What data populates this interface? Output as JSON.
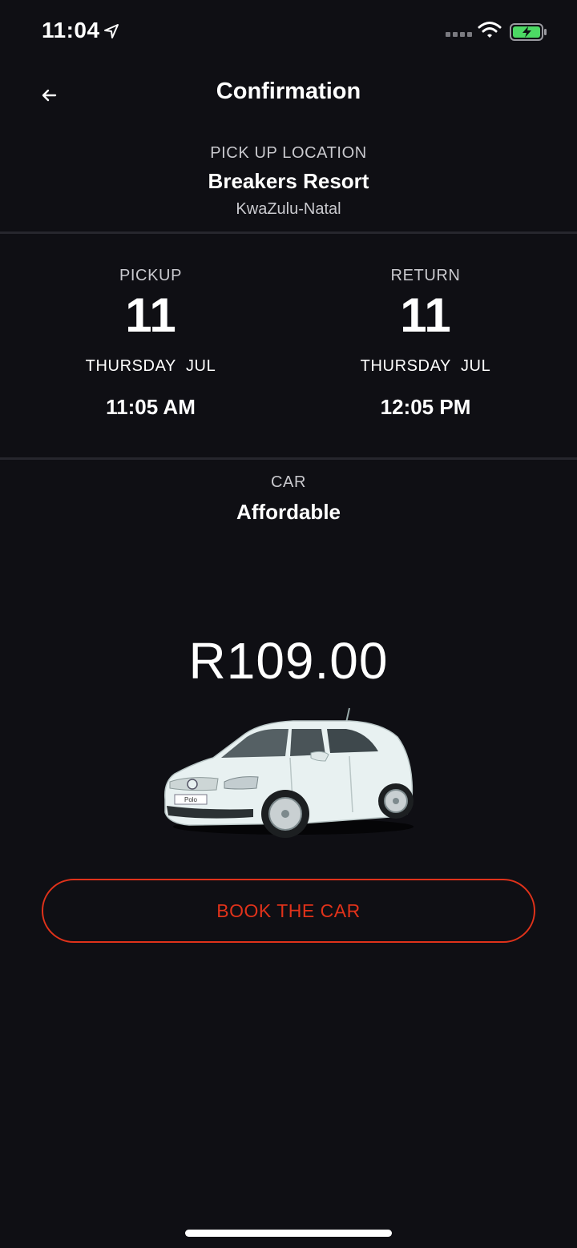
{
  "status_bar": {
    "time": "11:04",
    "icons": [
      "location-arrow-icon",
      "signal-icon",
      "wifi-icon",
      "battery-charging-icon"
    ],
    "battery_color": "#4cd964"
  },
  "nav": {
    "back_icon": "arrow-left-icon",
    "title": "Confirmation"
  },
  "pickup_location": {
    "label": "PICK UP LOCATION",
    "name": "Breakers Resort",
    "region": "KwaZulu-Natal"
  },
  "pickup": {
    "label": "PICKUP",
    "day": "11",
    "weekday_month": "THURSDAY  JUL",
    "time": "11:05 AM"
  },
  "return": {
    "label": "RETURN",
    "day": "11",
    "weekday_month": "THURSDAY  JUL",
    "time": "12:05 PM"
  },
  "car": {
    "label": "CAR",
    "name": "Affordable",
    "price": "R109.00",
    "image_icon": "car-image",
    "plate_text": "Polo"
  },
  "actions": {
    "book_label": "BOOK THE CAR"
  },
  "colors": {
    "background": "#0f0f14",
    "accent": "#e0321a",
    "divider": "#26262d",
    "muted_text": "#c9c9ce"
  }
}
